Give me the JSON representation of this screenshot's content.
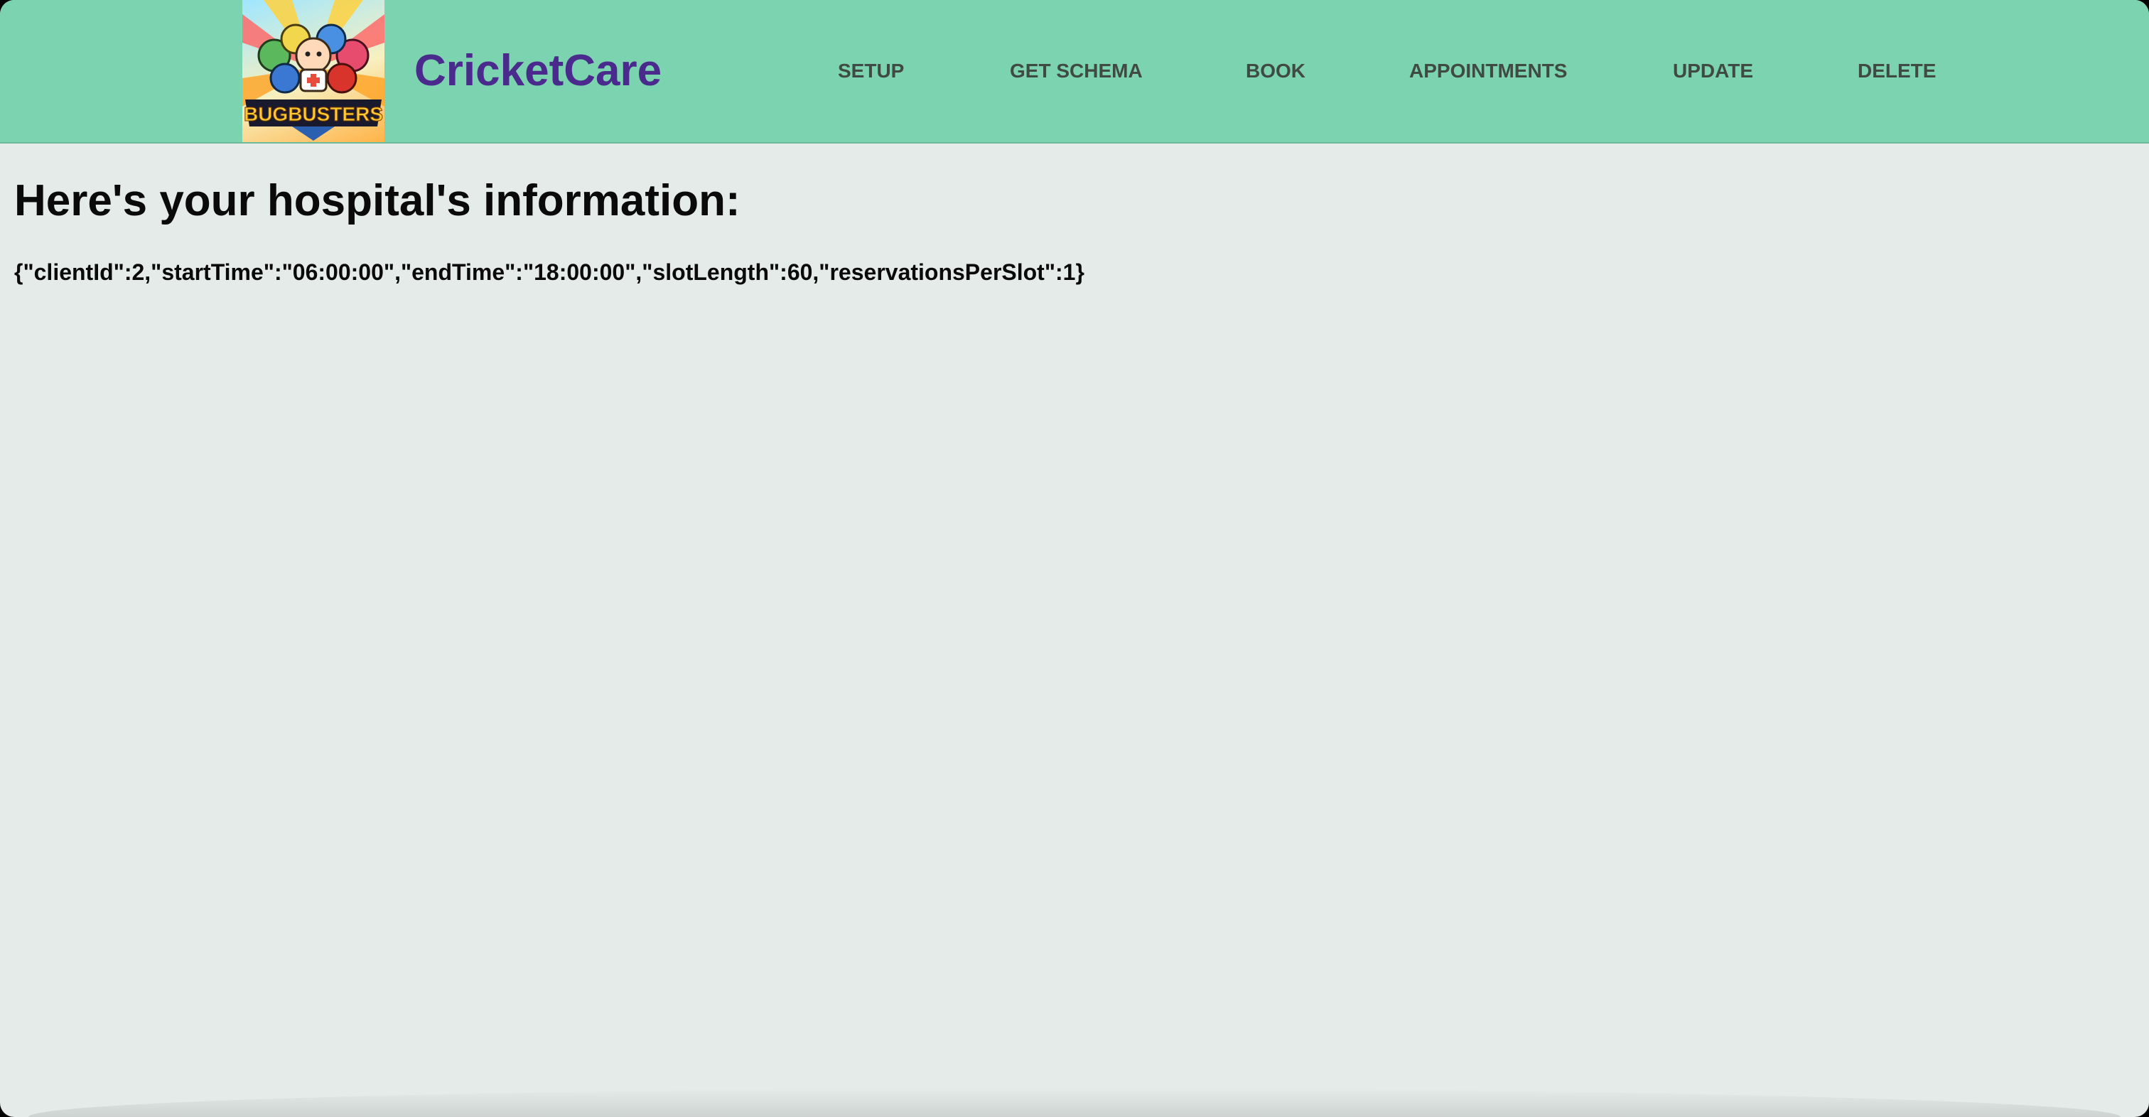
{
  "app": {
    "brand": "CricketCare",
    "logo_text": "BUGBUSTERS",
    "colors": {
      "navbar": "#7cd3af",
      "brand": "#4a2a8c",
      "background": "#e5ebe8",
      "nav_text": "#3f4a45"
    }
  },
  "nav": {
    "items": [
      {
        "label": "SETUP"
      },
      {
        "label": "GET SCHEMA"
      },
      {
        "label": "BOOK"
      },
      {
        "label": "APPOINTMENTS"
      },
      {
        "label": "UPDATE"
      },
      {
        "label": "DELETE"
      }
    ]
  },
  "main": {
    "heading": "Here's your hospital's information:",
    "info_json": "{\"clientId\":2,\"startTime\":\"06:00:00\",\"endTime\":\"18:00:00\",\"slotLength\":60,\"reservationsPerSlot\":1}"
  }
}
